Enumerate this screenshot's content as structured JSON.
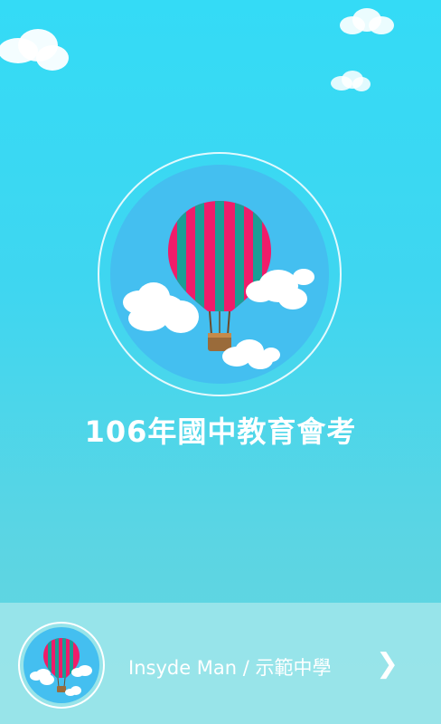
{
  "app": {
    "title": "106年國中教育會考"
  },
  "school_selector": {
    "label": "Insyde Man / 示範中學",
    "chevron": "❯"
  },
  "colors": {
    "background_top": "#34dbf6",
    "background_bottom": "#66d6df",
    "logo_circle": "#44bff0",
    "balloon_pink": "#f01c6a",
    "balloon_teal": "#1a9e96",
    "basket": "#9a6b3a"
  },
  "icons": {
    "logo": "hot-air-balloon-icon",
    "chevron": "chevron-right-icon"
  }
}
